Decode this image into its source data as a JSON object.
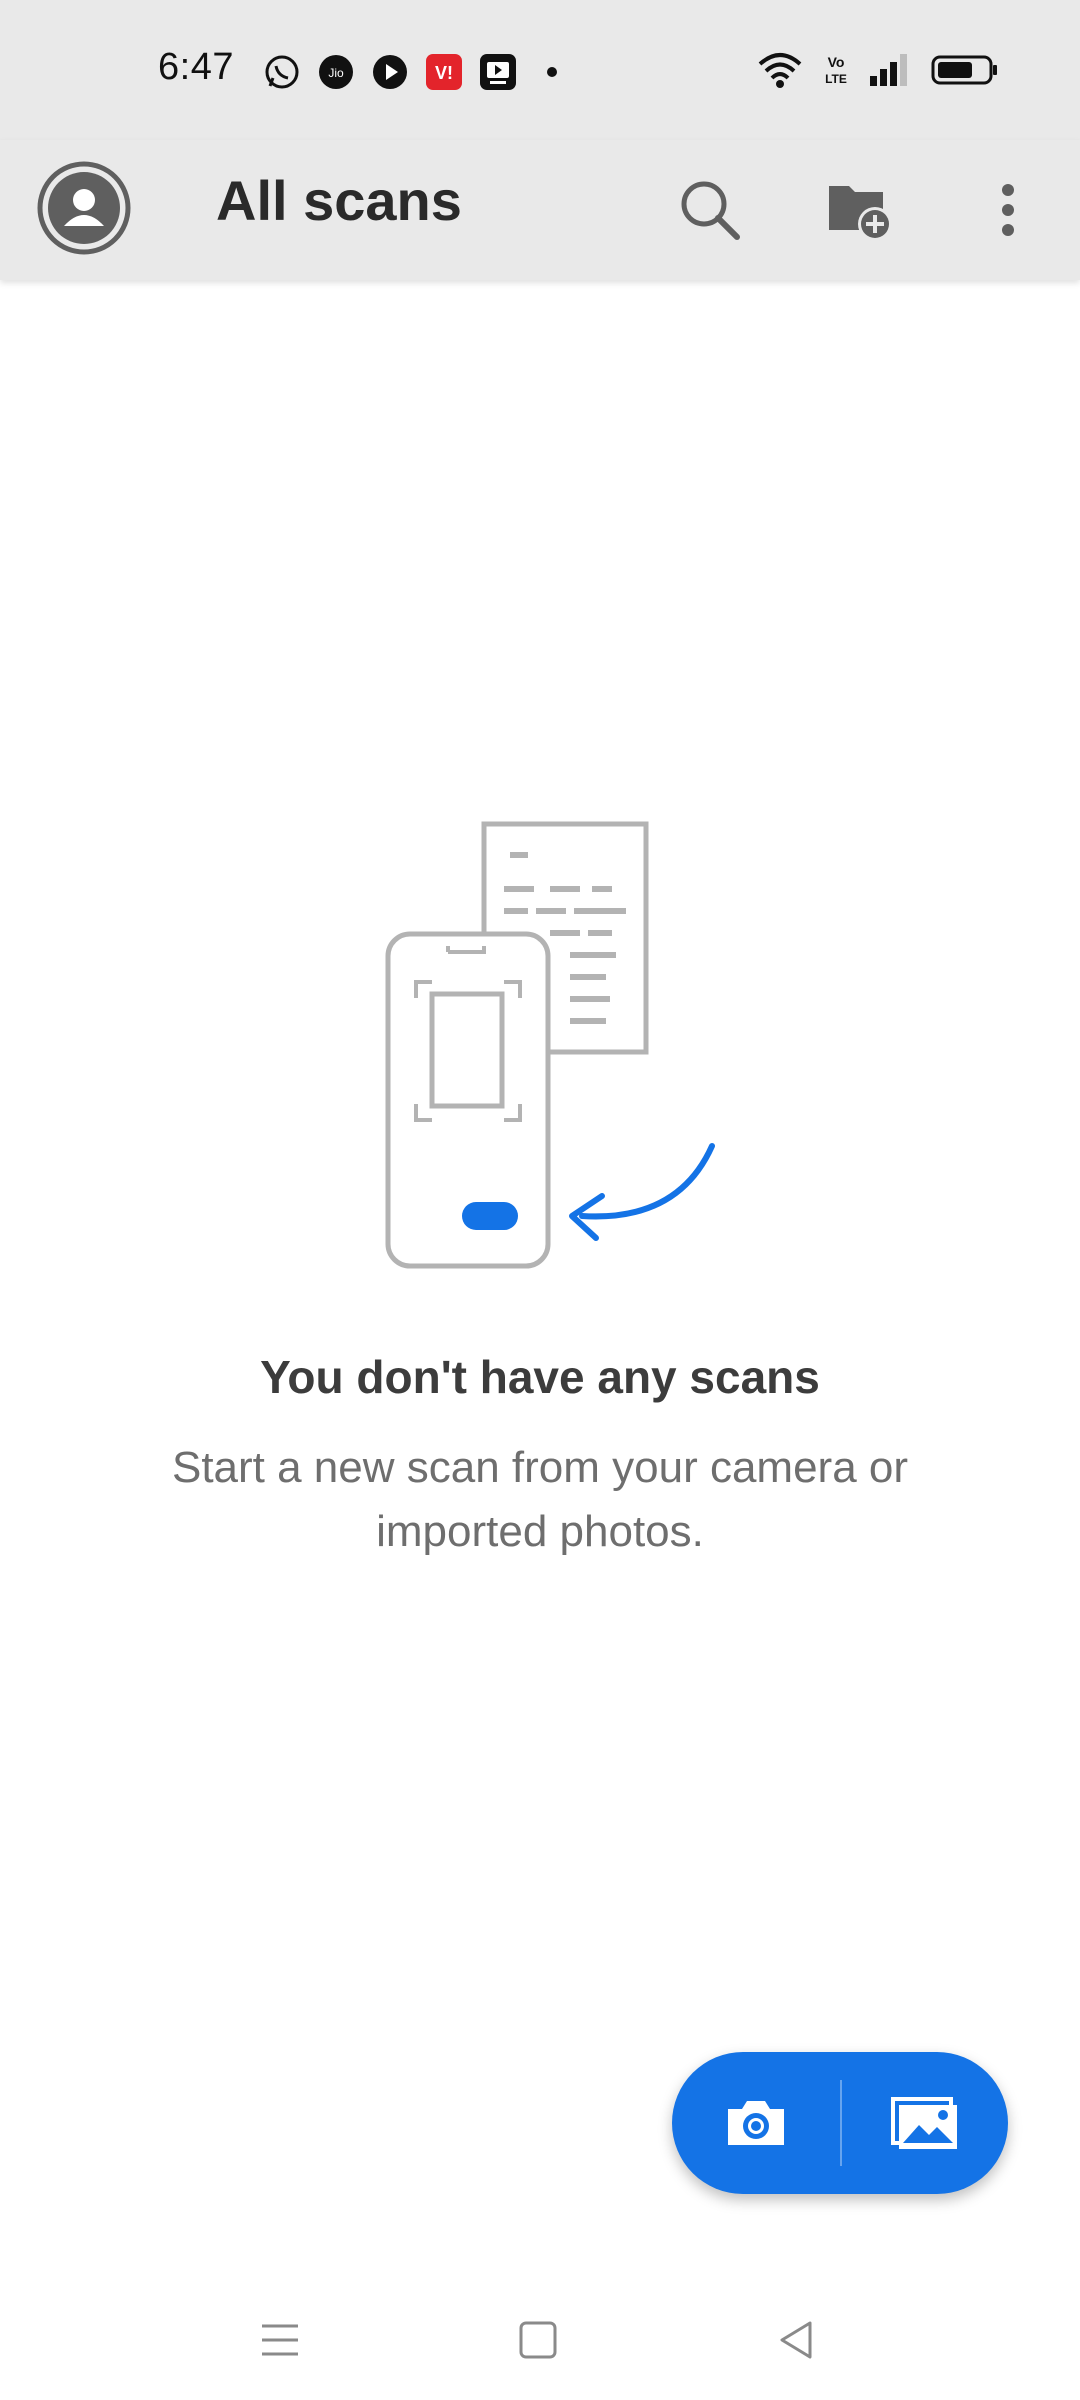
{
  "status_bar": {
    "time": "6:47",
    "left_icons": [
      "whatsapp-icon",
      "jio-icon",
      "play-icon",
      "vi-icon",
      "youtube-icon",
      "dot-icon"
    ],
    "right_icons": [
      "wifi-icon",
      "volte-icon",
      "signal-icon",
      "battery-icon"
    ],
    "volte_text": "Vo LTE"
  },
  "app_bar": {
    "title": "All scans",
    "icons": [
      "avatar-icon",
      "search-icon",
      "new-folder-icon",
      "more-vert-icon"
    ]
  },
  "empty_state": {
    "title": "You don't have any scans",
    "description": "Start a new scan from your camera or imported photos."
  },
  "fab": {
    "icons": [
      "camera-icon",
      "image-gallery-icon"
    ],
    "accent_color": "#1473e6"
  },
  "nav_bar": {
    "icons": [
      "menu-icon",
      "home-square-icon",
      "back-triangle-icon"
    ]
  },
  "colors": {
    "header_bg": "#e9e9e9",
    "accent": "#1473e6",
    "illustration_gray": "#b3b3b3"
  }
}
